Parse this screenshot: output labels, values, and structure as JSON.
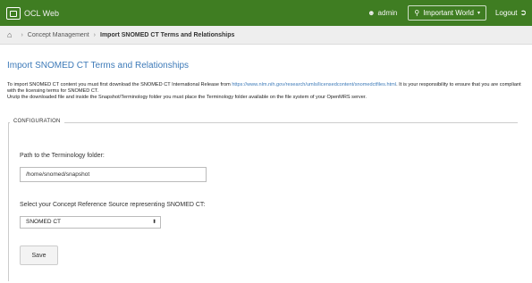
{
  "app": {
    "title": "OCL Web"
  },
  "navbar": {
    "user_icon": "person-icon",
    "user": "admin",
    "workspace_icon": "map-marker-icon",
    "workspace": "Important World",
    "workspace_caret": "▾",
    "logout": "Logout",
    "logout_icon": "logout-arrow-icon"
  },
  "breadcrumb": {
    "home_icon": "home-icon",
    "items": [
      "Concept Management",
      "Import SNOMED CT Terms and Relationships"
    ]
  },
  "page": {
    "title": "Import SNOMED CT Terms and Relationships",
    "intro_prefix": "To import SNOMED CT content you must first download the SNOMED CT International Release from ",
    "intro_link": "https://www.nlm.nih.gov/research/umls/licensedcontent/snomedctfiles.html",
    "intro_suffix": ". It is your responsibility to ensure that you are compliant with the licensing terms for SNOMED CT.",
    "intro_line2": "Unzip the downloaded file and inside the Snapshot/Terminology folder you must place the Terminology folder available on the file system of your OpenMRS server."
  },
  "configuration": {
    "legend": "CONFIGURATION",
    "path_label": "Path to the Terminology folder:",
    "path_value": "/home/snomed/snapshot",
    "source_label": "Select your Concept Reference Source representing SNOMED CT:",
    "source_value": "SNOMED CT",
    "source_arrow": "⬍",
    "save_label": "Save"
  },
  "colors": {
    "navbar": "#3f7d22",
    "title": "#3d7ab8",
    "link": "#3d7ab8"
  }
}
